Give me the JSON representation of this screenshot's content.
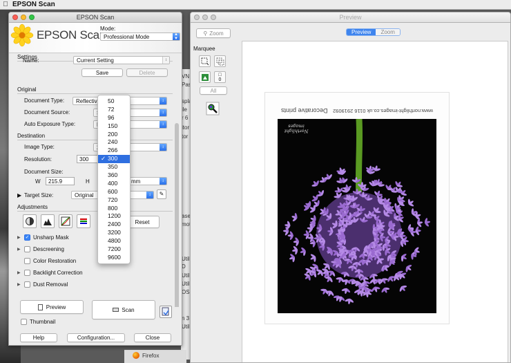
{
  "menubar": {
    "app_name": "EPSON Scan"
  },
  "scan_window": {
    "title": "EPSON Scan",
    "logo_text": "EPSON Scan",
    "mode_label": "Mode:",
    "mode_value": "Professional Mode",
    "settings": {
      "section_label": "Settings",
      "name_label": "Name:",
      "name_value": "Current Setting",
      "save_label": "Save",
      "delete_label": "Delete"
    },
    "original": {
      "section_label": "Original",
      "document_type_label": "Document Type:",
      "document_type_value": "Reflective",
      "document_source_label": "Document Source:",
      "document_source_value": "S",
      "auto_exposure_label": "Auto Exposure Type:",
      "auto_exposure_value": "P"
    },
    "destination": {
      "section_label": "Destination",
      "image_type_label": "Image Type:",
      "image_type_value": "2",
      "resolution_label": "Resolution:",
      "resolution_value": "300",
      "document_size_label": "Document Size:",
      "width_label": "W",
      "width_value": "215.9",
      "height_label": "H",
      "unit_value": "mm"
    },
    "target_size": {
      "label": "Target Size:",
      "value": "Original"
    },
    "adjustments": {
      "section_label": "Adjustments",
      "reset_label": "Reset",
      "options": [
        {
          "label": "Unsharp Mask",
          "checked": true,
          "expandable": true
        },
        {
          "label": "Descreening",
          "checked": false,
          "expandable": true
        },
        {
          "label": "Color Restoration",
          "checked": false,
          "expandable": false
        },
        {
          "label": "Backlight Correction",
          "checked": false,
          "expandable": true
        },
        {
          "label": "Dust Removal",
          "checked": false,
          "expandable": true
        }
      ]
    },
    "preview_button": "Preview",
    "scan_button": "Scan",
    "thumbnail_label": "Thumbnail",
    "help_button": "Help",
    "configuration_button": "Configuration...",
    "close_button": "Close"
  },
  "resolution_menu": {
    "options": [
      "50",
      "72",
      "96",
      "150",
      "200",
      "240",
      "266",
      "300",
      "350",
      "360",
      "400",
      "600",
      "720",
      "800",
      "1200",
      "2400",
      "3200",
      "4800",
      "7200",
      "9600"
    ],
    "selected": "300"
  },
  "preview_window": {
    "title": "Preview",
    "zoom_button": "Zoom",
    "tabs": {
      "preview": "Preview",
      "zoom": "Zoom"
    },
    "marquee_label": "Marquee",
    "marquee_count": "0",
    "all_button": "All",
    "print_site": "www.northlight-images.co.uk  0116 2919092",
    "print_title": "Decorative prints",
    "watermark": "Northlight images"
  },
  "background_text": {
    "lines": [
      "VN",
      "Pas",
      "spla",
      "ile",
      "r 6",
      "itor",
      "tor",
      "ase",
      "mot",
      "Util",
      "D",
      "Util",
      "Util",
      "OS",
      "n 3",
      "Util"
    ],
    "dock_label": "Firefox"
  },
  "colors": {
    "accent": "#2f6fe0",
    "window_bg": "#ececec",
    "flower": "#9a6ad0",
    "stem": "#5a9a22"
  }
}
